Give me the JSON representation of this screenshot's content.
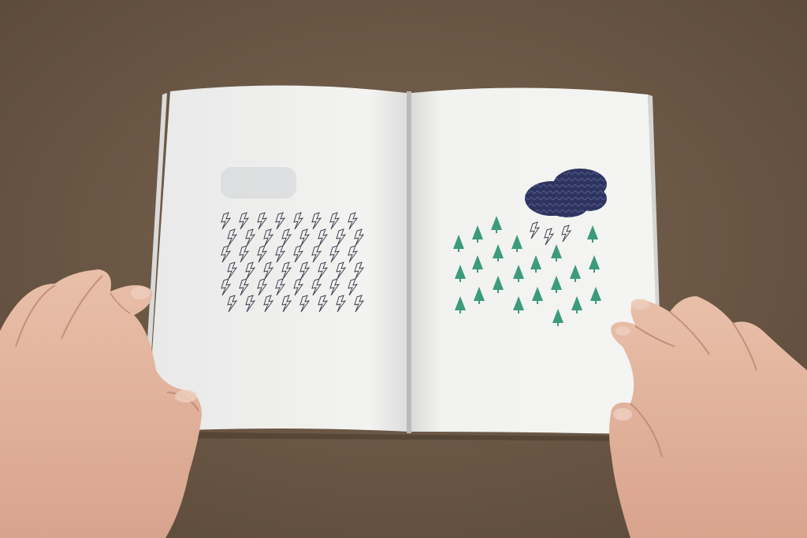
{
  "scene": {
    "subject": "open-sketchbook-on-table",
    "colors": {
      "table": "#6f5b47",
      "table_dark": "#5a4838",
      "page": "#f2f2f0",
      "page_shade": "#e2e3e2",
      "cloud": "#2d3460",
      "tree": "#3b9b7c",
      "bolt": "#3e4150",
      "skin": "#e2b39e",
      "skin_shadow": "#c48f78"
    },
    "left_page": {
      "motif": "lightning-bolt-outlines",
      "rows": 6,
      "cols": 8
    },
    "right_page": {
      "motif": "green-pine-trees-with-cloud",
      "tree_count": 27,
      "bolt_count": 3
    }
  }
}
